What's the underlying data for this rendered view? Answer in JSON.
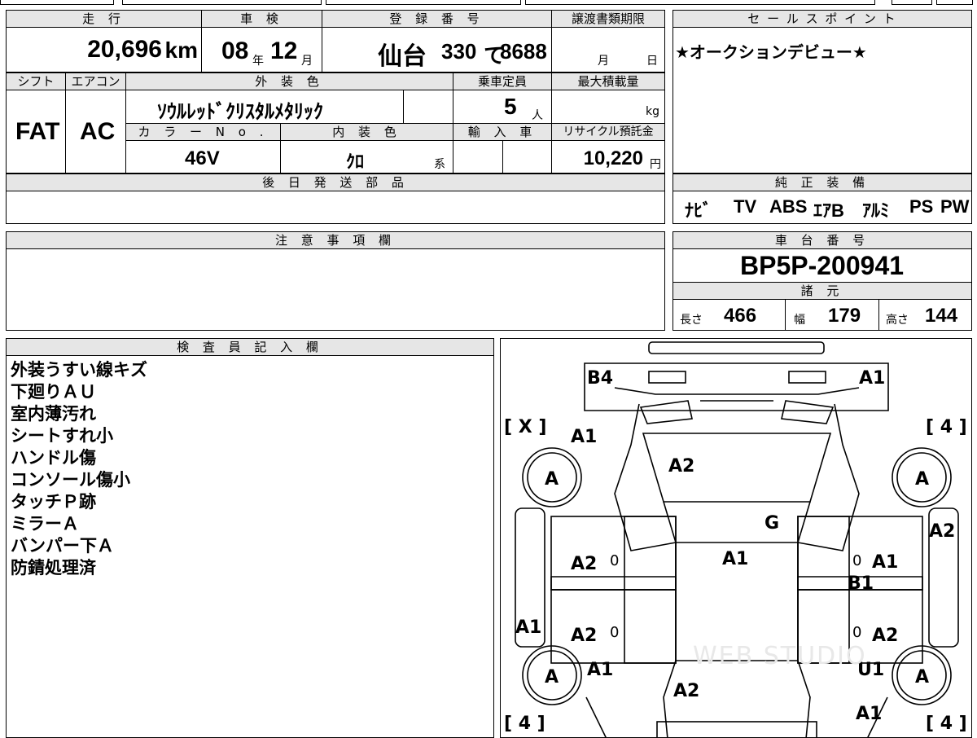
{
  "header": {
    "mileage_label": "走 行",
    "inspection_label": "車 検",
    "plate_label": "登 録 番 号",
    "transfer_label": "譲渡書類期限",
    "sales_label": "セ ー ル ス ポ イ ン ト"
  },
  "values": {
    "mileage": "20,696",
    "mileage_unit": "km",
    "inspection_year": "08",
    "year_unit": "年",
    "inspection_month": "12",
    "month_unit": "月",
    "plate_region": "仙台",
    "plate_class": "330",
    "plate_kana": "て",
    "plate_number": "8688",
    "transfer_month_unit": "月",
    "transfer_day_unit": "日",
    "sales_point": "★オークションデビュー★"
  },
  "specs": {
    "shift_label": "シフト",
    "ac_label": "エアコン",
    "exterior_label": "外 装 色",
    "capacity_label": "乗車定員",
    "maxload_label": "最大積載量",
    "shift": "FAT",
    "ac": "AC",
    "exterior_color": "ｿｳﾙﾚｯﾄﾞｸﾘｽﾀﾙﾒﾀﾘｯｸ",
    "capacity": "5",
    "capacity_unit": "人",
    "maxload_unit": "kg",
    "color_no_label": "カ ラ ー N o .",
    "interior_label": "内 装 色",
    "import_label": "輸 入 車",
    "recycle_label": "リサイクル預託金",
    "color_no": "46V",
    "interior_color": "ｸﾛ",
    "interior_suffix": "系",
    "recycle_fee": "10,220",
    "recycle_unit": "円"
  },
  "later_parts": {
    "label": "後 日 発 送 部 品"
  },
  "equipment": {
    "label": "純 正 装 備",
    "items": [
      "ﾅﾋﾞ",
      "TV",
      "ABS",
      "ｴｱB",
      "ｱﾙﾐ",
      "PS",
      "PW"
    ]
  },
  "notes": {
    "label": "注 意 事 項 欄"
  },
  "chassis": {
    "label": "車 台 番 号",
    "number": "BP5P-200941",
    "dims_label": "諸 元",
    "length_label": "長さ",
    "length": "466",
    "width_label": "幅",
    "width": "179",
    "height_label": "高さ",
    "height": "144"
  },
  "inspector": {
    "label": "検 査 員 記 入 欄",
    "lines": [
      "外装うすい線キズ",
      "下廻りＡＵ",
      "室内薄汚れ",
      "シートすれ小",
      "ハンドル傷",
      "コンソール傷小",
      "タッチＰ跡",
      "ミラーＡ",
      "バンパー下Ａ",
      "防錆処理済"
    ]
  },
  "diagram": {
    "labels": [
      "B4",
      "A1",
      "A1",
      "A2",
      "A",
      "A",
      "G",
      "A2",
      "A1",
      "A2",
      "0",
      "A1",
      "0",
      "B1",
      "A1",
      "A2",
      "0",
      "0",
      "A2",
      "A",
      "A1",
      "A2",
      "U1",
      "A",
      "A1"
    ],
    "tire_left_top": "[ X ]",
    "tire_right_top": "[ 4 ]",
    "tire_left_bottom": "[ 4 ]",
    "tire_right_bottom": "[ 4 ]",
    "watermark": "WEB STUDIO"
  }
}
